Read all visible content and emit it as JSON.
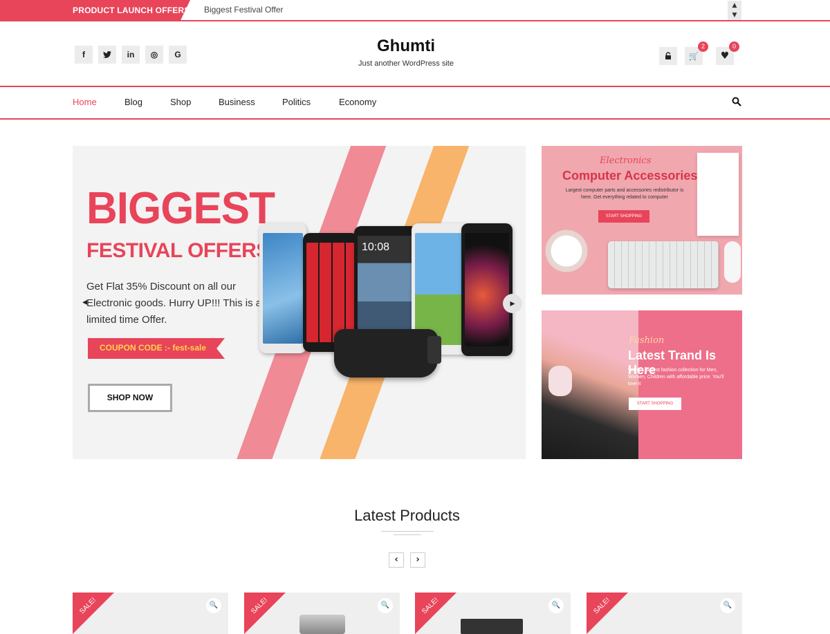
{
  "topbar": {
    "badge": "PRODUCT LAUNCH OFFERS",
    "ticker": "Biggest Festival Offer",
    "up_icon": "chevron-up-icon",
    "down_icon": "chevron-down-icon"
  },
  "header": {
    "title": "Ghumti",
    "tagline": "Just another WordPress site",
    "social": [
      {
        "glyph": "f",
        "icon": "facebook-icon"
      },
      {
        "glyph": "t",
        "icon": "twitter-icon"
      },
      {
        "glyph": "in",
        "icon": "linkedin-icon"
      },
      {
        "glyph": "◎",
        "icon": "instagram-icon"
      },
      {
        "glyph": "G",
        "icon": "google-icon"
      }
    ],
    "cart_count": "2",
    "wishlist_count": "0"
  },
  "nav": {
    "items": [
      "Home",
      "Blog",
      "Shop",
      "Business",
      "Politics",
      "Economy"
    ],
    "active": "Home"
  },
  "hero": {
    "headline": "BIGGEST",
    "subheadline": "FESTIVAL OFFERS",
    "text": "Get Flat 35% Discount on all our Electronic goods. Hurry UP!!! This is a limited time Offer.",
    "coupon": "COUPON CODE :- fest-sale",
    "button": "SHOP NOW",
    "phone_clock": "10:08"
  },
  "banners": {
    "top": {
      "script": "Electronics",
      "title": "Computer Accessories",
      "desc": "Largest computer parts and accessories redistributor is here. Get everything related to computer",
      "button": "START SHOPPING"
    },
    "bottom": {
      "script": "Fashion",
      "title": "Latest Trand Is Here",
      "desc": "World's largest fashion collection for Men, Women, Children with affordable price. You'll love it",
      "button": "START SHOPPING"
    }
  },
  "section": {
    "title": "Latest Products"
  },
  "products": {
    "sale_label": "SALE!"
  },
  "colors": {
    "accent": "#e8445a",
    "stripe_pink": "#f08a95",
    "stripe_orange": "#f8b46a"
  }
}
